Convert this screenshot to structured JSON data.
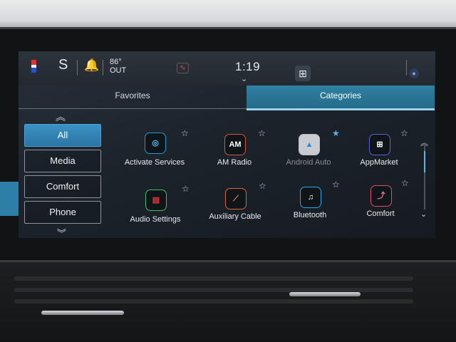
{
  "status": {
    "drive_mode": "S",
    "temp_value": "86°",
    "temp_label": "OUT",
    "time": "1:19",
    "wifi_icon": "wifi-alert-icon",
    "bell_icon": "bell-icon",
    "apps_icon": "app-grid-icon",
    "mic_icon": "voice-icon"
  },
  "tabs": [
    {
      "label": "Favorites",
      "active": false
    },
    {
      "label": "Categories",
      "active": true
    }
  ],
  "categories": [
    {
      "label": "All",
      "active": true
    },
    {
      "label": "Media",
      "active": false
    },
    {
      "label": "Comfort",
      "active": false
    },
    {
      "label": "Phone",
      "active": false
    }
  ],
  "apps": [
    {
      "label": "Activate Services",
      "icon": "activate-services-icon",
      "glyph": "◎",
      "favorite": false,
      "enabled": true,
      "border": "#1e9ad6"
    },
    {
      "label": "AM Radio",
      "icon": "am-radio-icon",
      "glyph": "AM",
      "favorite": false,
      "enabled": true,
      "border": "#d8563a"
    },
    {
      "label": "Android Auto",
      "icon": "android-auto-icon",
      "glyph": "▲",
      "favorite": true,
      "enabled": false,
      "border": "#b9bec3"
    },
    {
      "label": "AppMarket",
      "icon": "appmarket-icon",
      "glyph": "⊞",
      "favorite": false,
      "enabled": true,
      "border": "#5a63d8"
    },
    {
      "label": "Audio Settings",
      "icon": "audio-settings-icon",
      "glyph": "▤",
      "favorite": false,
      "enabled": true,
      "border": "#3fbf6a"
    },
    {
      "label": "Auxiliary Cable",
      "icon": "auxiliary-cable-icon",
      "glyph": "⟋",
      "favorite": false,
      "enabled": true,
      "border": "#d8683a"
    },
    {
      "label": "Bluetooth",
      "icon": "bluetooth-icon",
      "glyph": "♫",
      "favorite": false,
      "enabled": true,
      "border": "#2ca6e0"
    },
    {
      "label": "Comfort",
      "icon": "comfort-icon",
      "glyph": "⤴",
      "favorite": false,
      "enabled": true,
      "border": "#e04b6e"
    }
  ],
  "colors": {
    "accent": "#2b86b6",
    "favorite_star": "#5fb2e8"
  }
}
